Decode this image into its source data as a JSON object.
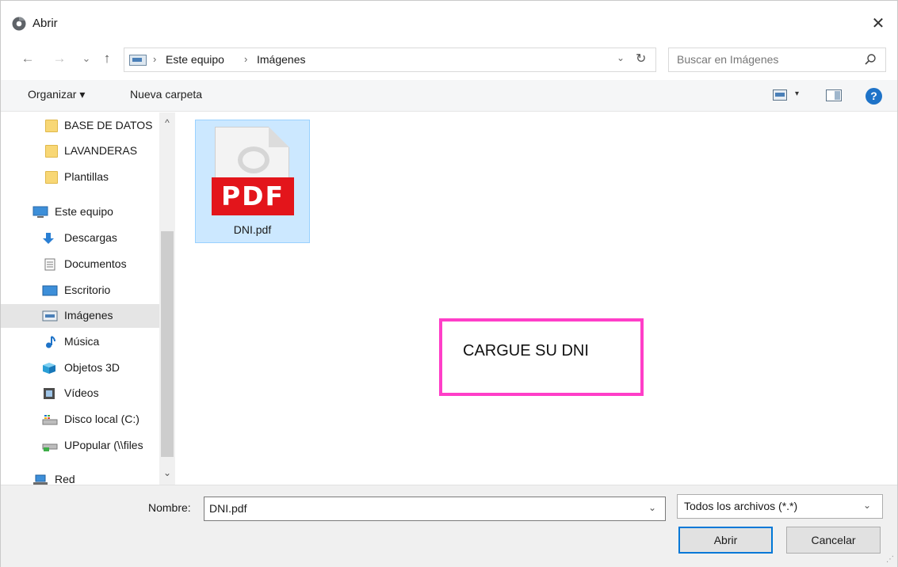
{
  "window": {
    "title": "Abrir",
    "close_label": "✕"
  },
  "nav": {
    "back": "←",
    "forward": "→",
    "recent": "⌄",
    "up": "↑"
  },
  "address": {
    "crumbs": [
      "Este equipo",
      "Imágenes"
    ],
    "separator": "›",
    "dropdown": "⌄",
    "refresh": "↻"
  },
  "search": {
    "placeholder": "Buscar en Imágenes"
  },
  "toolbar": {
    "organize": "Organizar ▾",
    "new_folder": "Nueva carpeta",
    "view_dropdown": "▾",
    "help": "?"
  },
  "sidebar": {
    "scroll_up": "^",
    "scroll_down": "⌄",
    "items": [
      {
        "label": "BASE DE DATOS",
        "icon": "folder-icon"
      },
      {
        "label": "LAVANDERAS",
        "icon": "folder-icon"
      },
      {
        "label": "Plantillas",
        "icon": "folder-icon"
      },
      {
        "label": "Este equipo",
        "icon": "computer-icon"
      },
      {
        "label": "Descargas",
        "icon": "download-icon"
      },
      {
        "label": "Documentos",
        "icon": "document-icon"
      },
      {
        "label": "Escritorio",
        "icon": "desktop-icon"
      },
      {
        "label": "Imágenes",
        "icon": "pictures-icon",
        "selected": true
      },
      {
        "label": "Música",
        "icon": "music-icon"
      },
      {
        "label": "Objetos 3D",
        "icon": "cube-icon"
      },
      {
        "label": "Vídeos",
        "icon": "video-icon"
      },
      {
        "label": "Disco local (C:)",
        "icon": "drive-icon"
      },
      {
        "label": "UPopular (\\\\files",
        "icon": "network-drive-icon"
      },
      {
        "label": "Red",
        "icon": "network-icon"
      }
    ]
  },
  "files": [
    {
      "name": "DNI.pdf",
      "badge": "PDF",
      "selected": true
    }
  ],
  "annotation": {
    "text": "CARGUE SU DNI"
  },
  "footer": {
    "name_label": "Nombre:",
    "name_value": "DNI.pdf",
    "name_dropdown": "⌄",
    "filter_value": "Todos los archivos (*.*)",
    "filter_dropdown": "⌄",
    "open_button": "Abrir",
    "cancel_button": "Cancelar"
  },
  "colors": {
    "accent": "#0078d7",
    "selection": "#cce8ff",
    "annotation_border": "#ff3ec8",
    "pdf_red": "#e3151b"
  }
}
